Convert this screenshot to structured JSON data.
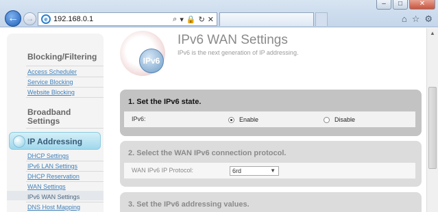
{
  "browser": {
    "address": "192.168.0.1",
    "addr_tools": [
      "⌕",
      "▾",
      "🔒",
      "↻",
      "✕"
    ],
    "win_controls": [
      "–",
      "□",
      "✕"
    ],
    "toolbar_icons": [
      "⌂",
      "☆",
      "⚙"
    ]
  },
  "sidebar": {
    "sections": [
      {
        "heading": "Blocking/Filtering",
        "links": [
          "Access Scheduler",
          "Service Blocking",
          "Website Blocking"
        ]
      },
      {
        "heading_lines": [
          "Broadband",
          "Settings"
        ]
      },
      {
        "heading": "IP Addressing",
        "links": [
          "DHCP Settings",
          "IPv6 LAN Settings",
          "DHCP Reservation",
          "WAN Settings",
          "IPv6 WAN Settings",
          "DNS Host Mapping"
        ]
      }
    ]
  },
  "header": {
    "logo_text": "IPv6",
    "title": "IPv6 WAN Settings",
    "subtitle": "IPv6 is the next generation of IP addressing."
  },
  "section1": {
    "title": "1. Set the IPv6 state.",
    "label": "IPv6:",
    "options": [
      "Enable",
      "Disable"
    ],
    "selected": "Enable"
  },
  "section2": {
    "title": "2. Select the WAN IPv6 connection protocol.",
    "label": "WAN IPv6 IP Protocol:",
    "value": "6rd"
  },
  "section3": {
    "title": "3. Set the IPv6 addressing values."
  }
}
